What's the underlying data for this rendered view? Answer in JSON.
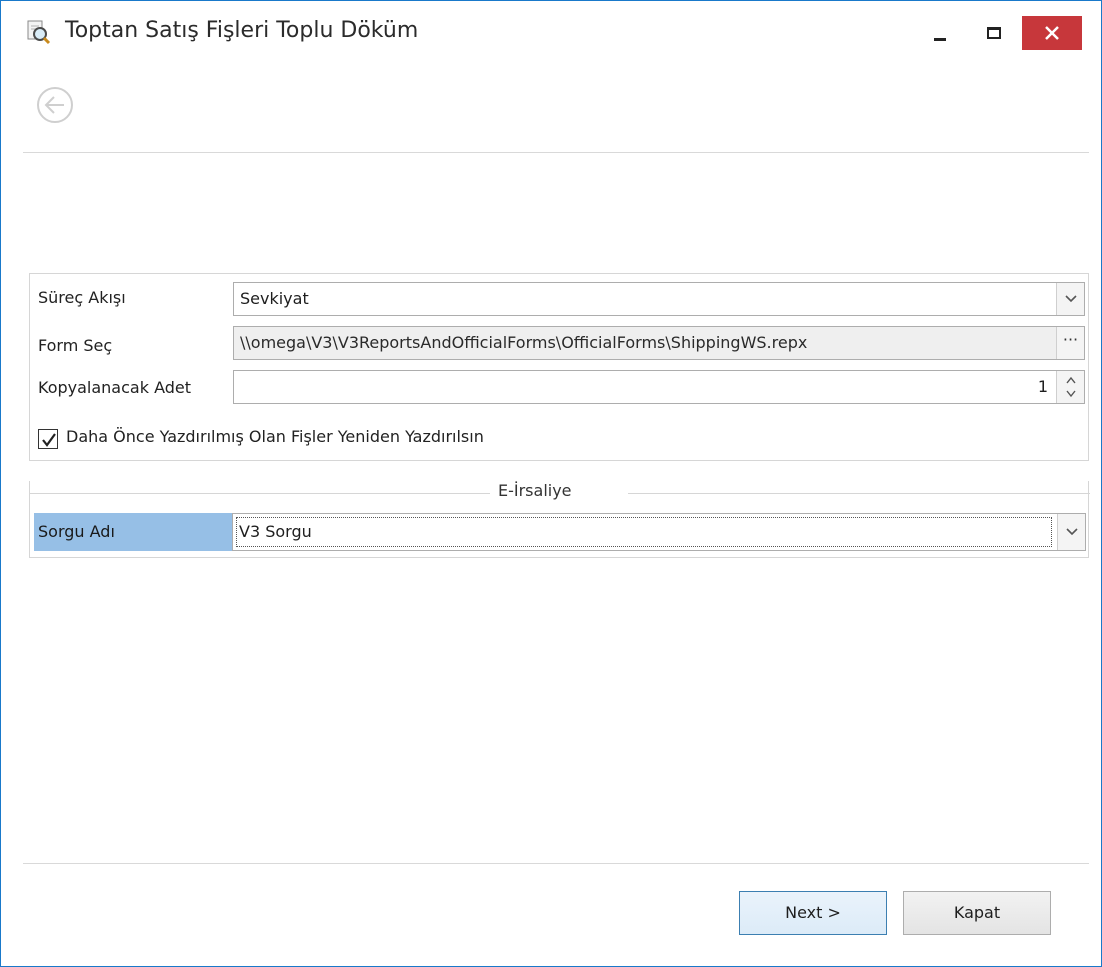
{
  "window": {
    "title": "Toptan Satış Fişleri Toplu Döküm",
    "icon": "magnifier-document-icon",
    "accent": "#c7373b"
  },
  "toolbar": {
    "back_icon": "back-arrow-icon"
  },
  "form": {
    "surec_akisi": {
      "label": "Süreç Akışı",
      "value": "Sevkiyat"
    },
    "form_sec": {
      "label": "Form Seç",
      "value": "\\\\omega\\V3\\V3ReportsAndOfficialForms\\OfficialForms\\ShippingWS.repx",
      "button": "···"
    },
    "kopya_adet": {
      "label": "Kopyalanacak Adet",
      "value": "1"
    },
    "reprint": {
      "label": "Daha Önce Yazdırılmış Olan Fişler Yeniden Yazdırılsın",
      "checked": true
    }
  },
  "e_irsaliye": {
    "caption": "E-İrsaliye",
    "sorgu_adi": {
      "label": "Sorgu Adı",
      "value": "V3 Sorgu"
    },
    "highlight": "#96bfe6"
  },
  "footer": {
    "next_label": "Next >",
    "close_label": "Kapat"
  }
}
